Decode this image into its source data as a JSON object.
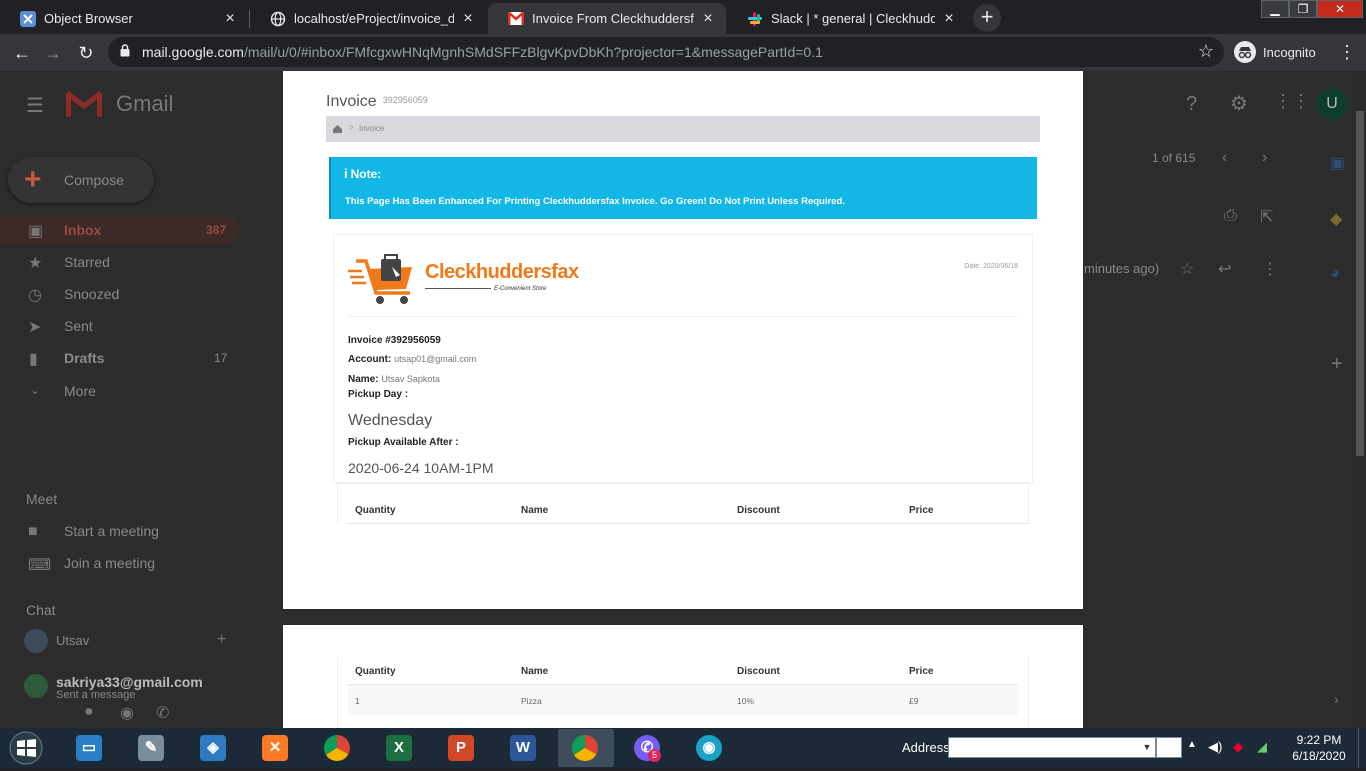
{
  "browser": {
    "tabs": [
      {
        "title": "Object Browser",
        "icon": "xampp-x-icon",
        "active": false
      },
      {
        "title": "localhost/eProject/invoice_downl",
        "icon": "globe-icon",
        "active": false
      },
      {
        "title": "Invoice From Cleckhuddersfax - u",
        "icon": "gmail-icon",
        "active": true
      },
      {
        "title": "Slack | * general | Cleckhuddersfa",
        "icon": "slack-icon",
        "active": false
      }
    ],
    "new_tab_label": "+",
    "url_host": "mail.google.com",
    "url_rest": "/mail/u/0/#inbox/FMfcgxwHNqMgnhSMdSFFzBlgvKpvDbKh?projector=1&messagePartId=0.1",
    "incognito_label": "Incognito"
  },
  "gmail": {
    "logo_text": "Gmail",
    "compose_label": "Compose",
    "nav": [
      {
        "label": "Inbox",
        "count": "387"
      },
      {
        "label": "Starred",
        "count": ""
      },
      {
        "label": "Snoozed",
        "count": ""
      },
      {
        "label": "Sent",
        "count": ""
      },
      {
        "label": "Drafts",
        "count": "17"
      },
      {
        "label": "More",
        "count": ""
      }
    ],
    "meet_heading": "Meet",
    "meet_items": [
      "Start a meeting",
      "Join a meeting"
    ],
    "chat_heading": "Chat",
    "chat_user": "Utsav",
    "chat_contact": "sakriya33@gmail.com",
    "chat_contact_sub": "Sent a message",
    "pagination": "1 of 615",
    "time_ago": "minutes ago)",
    "avatar_letter": "U"
  },
  "invoice": {
    "title": "Invoice",
    "title_number": "392956059",
    "breadcrumb_current": "Invoice",
    "breadcrumb_sep": ">",
    "note_heading": "Note:",
    "note_body": "This Page Has Been Enhanced For Printing Cleckhuddersfax Invoice.  Go Green! Do Not Print Unless Required.",
    "brand_name": "Cleckhuddersfax",
    "brand_tagline": "E-Convenient Store",
    "date": "Date: 2020/06/18",
    "invoice_label": "Invoice #392956059",
    "account_label": "Account:",
    "account_value": "utsap01@gmail.com",
    "name_label": "Name:",
    "name_value": "Utsav Sapkota",
    "pickup_day_label": "Pickup Day :",
    "pickup_day_value": "Wednesday",
    "pickup_after_label": "Pickup Available After :",
    "pickup_after_value": "2020-06-24 10AM-1PM",
    "table_headers": [
      "Quantity",
      "Name",
      "Discount",
      "Price"
    ],
    "rows": [
      {
        "quantity": "1",
        "name": "Pizza",
        "discount": "10%",
        "price": "£9"
      }
    ]
  },
  "taskbar": {
    "address_label": "Address",
    "time": "9:22 PM",
    "date": "6/18/2020",
    "viber_badge": "5",
    "apps": [
      "file-explorer",
      "paint",
      "virtualbox",
      "xampp",
      "chrome",
      "excel",
      "powerpoint",
      "word",
      "chrome",
      "viber",
      "vpn"
    ]
  }
}
